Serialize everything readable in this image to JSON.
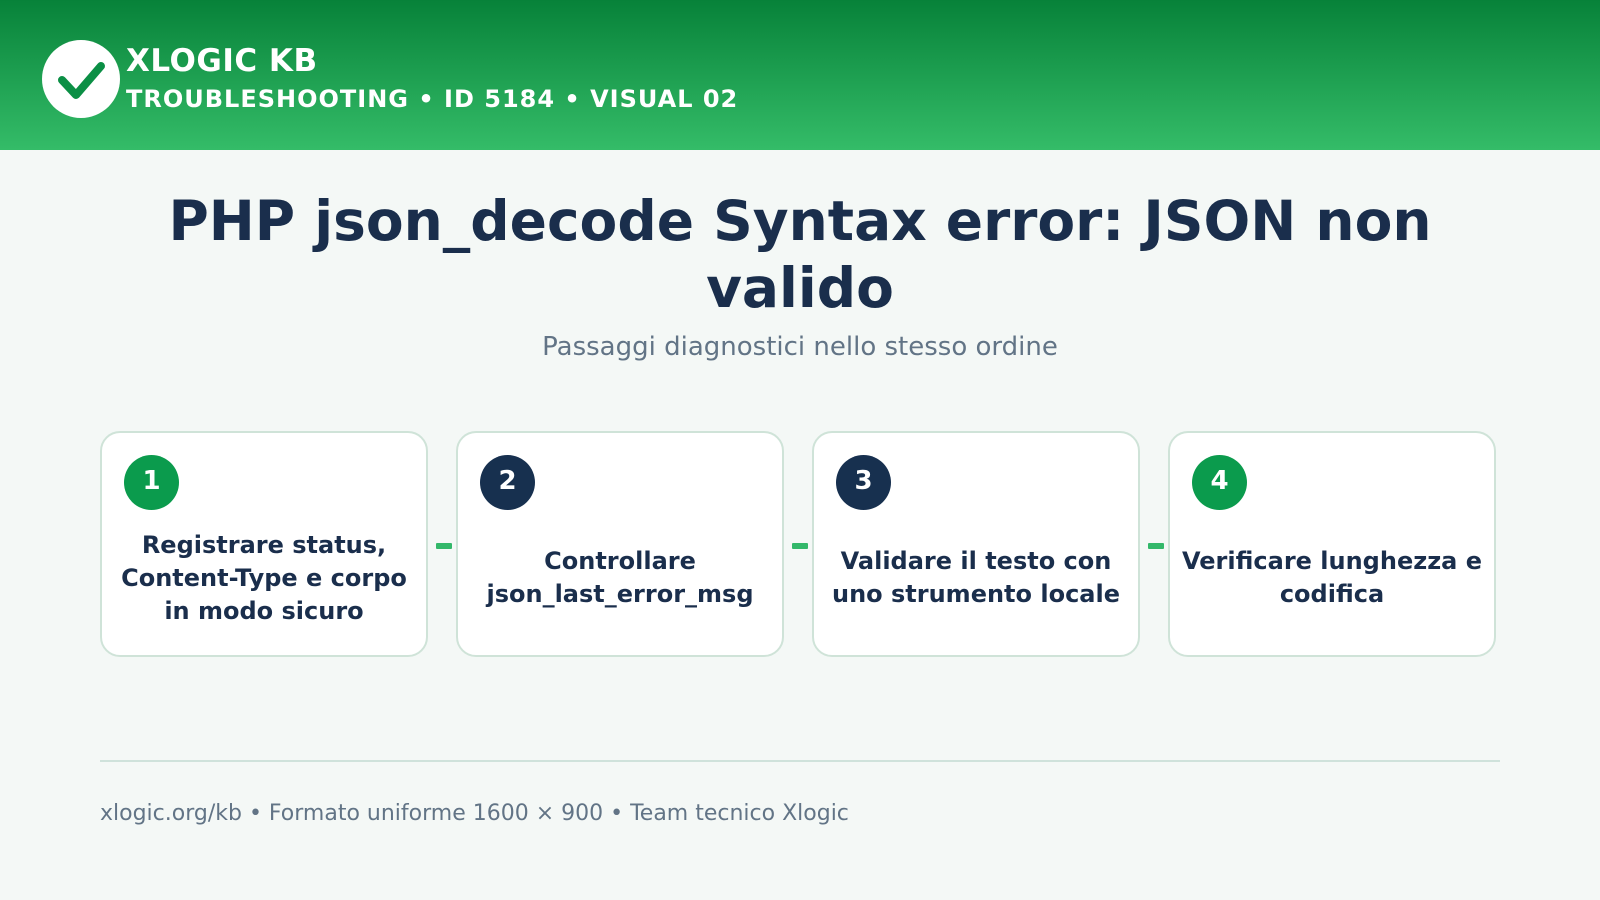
{
  "header": {
    "brand": "XLOGIC KB",
    "crumb": "TROUBLESHOOTING • ID 5184 • VISUAL 02",
    "logo_icon": "check-icon",
    "colors": {
      "gradient_top": "#078239",
      "gradient_bottom": "#34bc68"
    }
  },
  "main": {
    "title": "PHP json_decode Syntax error: JSON non valido",
    "subtitle": "Passaggi diagnostici nello stesso ordine"
  },
  "steps": [
    {
      "number": "1",
      "text": "Registrare status, Content-Type e corpo in modo sicuro",
      "badge_color": "#0b9b4d"
    },
    {
      "number": "2",
      "text": "Controllare json_last_error_msg",
      "badge_color": "#17304f"
    },
    {
      "number": "3",
      "text": "Validare il testo con uno strumento locale",
      "badge_color": "#17304f"
    },
    {
      "number": "4",
      "text": "Verificare lunghezza e codifica",
      "badge_color": "#0b9b4d"
    }
  ],
  "footer": {
    "text": "xlogic.org/kb • Formato uniforme 1600 × 900 • Team tecnico Xlogic"
  }
}
